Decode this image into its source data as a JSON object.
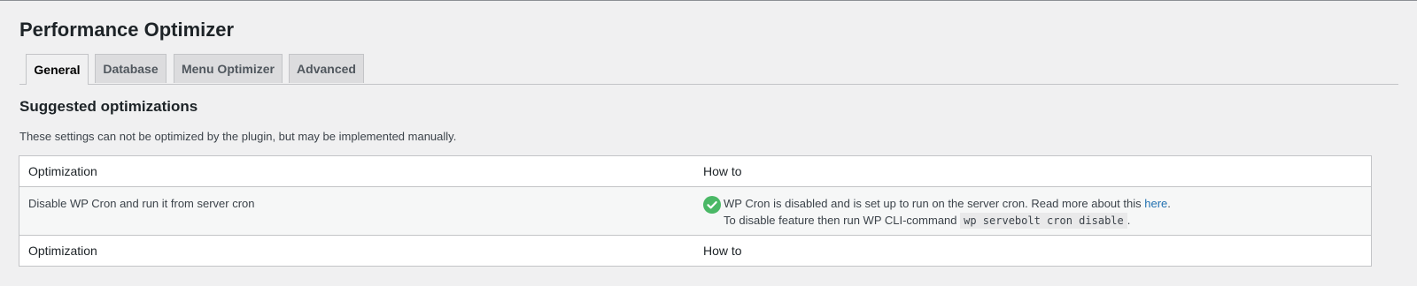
{
  "page": {
    "title": "Performance Optimizer"
  },
  "tabs": [
    {
      "label": "General",
      "active": true
    },
    {
      "label": "Database",
      "active": false
    },
    {
      "label": "Menu Optimizer",
      "active": false
    },
    {
      "label": "Advanced",
      "active": false
    }
  ],
  "section": {
    "title": "Suggested optimizations",
    "description": "These settings can not be optimized by the plugin, but may be implemented manually."
  },
  "table": {
    "header": {
      "col1": "Optimization",
      "col2": "How to"
    },
    "rows": [
      {
        "optimization": "Disable WP Cron and run it from server cron",
        "status_icon": "check-circle-icon",
        "howto_text": "WP Cron is disabled and is set up to run on the server cron. Read more about this ",
        "howto_link": "here",
        "howto_period": ".",
        "howto_line2_prefix": "To disable feature then run WP CLI-command ",
        "howto_command": "wp servebolt cron disable",
        "howto_line2_suffix": "."
      }
    ],
    "footer": {
      "col1": "Optimization",
      "col2": "How to"
    }
  },
  "colors": {
    "background": "#f0f0f1",
    "success": "#4ab866",
    "link": "#2271b1"
  }
}
